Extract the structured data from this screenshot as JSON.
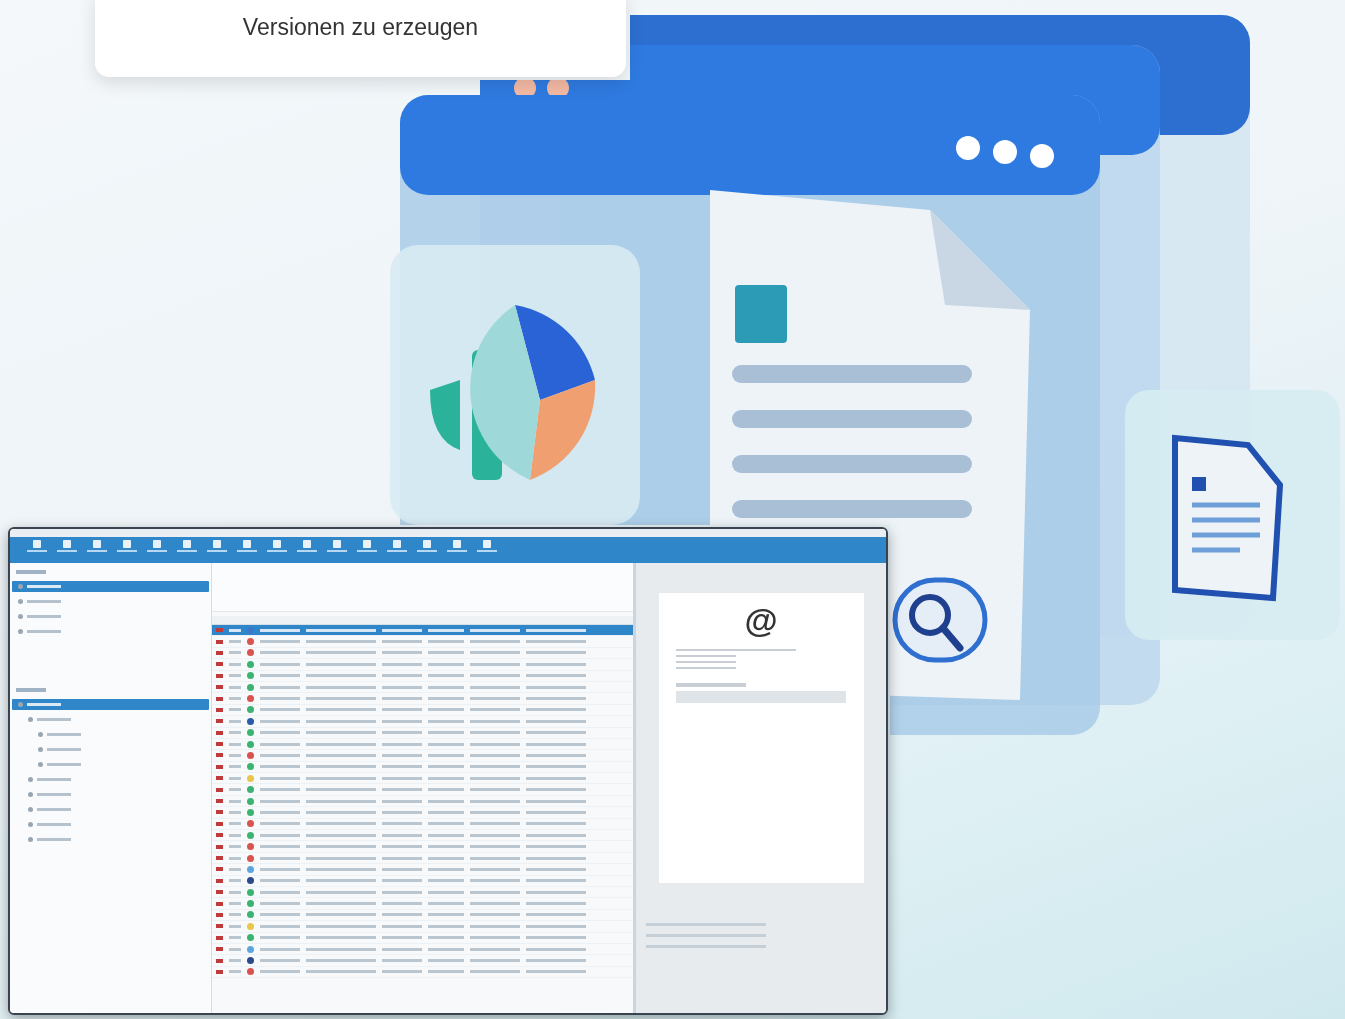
{
  "caption_card": {
    "text": "Versionen zu erzeugen"
  },
  "app_window": {
    "toolbar_buttons": [
      {
        "selected": false
      },
      {
        "selected": false
      },
      {
        "selected": false
      },
      {
        "selected": false
      },
      {
        "selected": false
      },
      {
        "selected": false
      },
      {
        "selected": false
      },
      {
        "selected": false
      },
      {
        "selected": false
      },
      {
        "selected": false
      },
      {
        "selected": false
      },
      {
        "selected": false
      },
      {
        "selected": false
      },
      {
        "selected": false
      },
      {
        "selected": false
      },
      {
        "selected": false
      }
    ],
    "views": [
      {
        "selected": true
      },
      {
        "selected": false
      },
      {
        "selected": false
      },
      {
        "selected": false
      }
    ],
    "folders": [
      {
        "selected": true,
        "children": [
          {
            "selected": false,
            "children": [
              {
                "selected": false
              },
              {
                "selected": false
              },
              {
                "selected": false
              }
            ]
          },
          {
            "selected": false
          },
          {
            "selected": false
          },
          {
            "selected": false
          },
          {
            "selected": false
          },
          {
            "selected": false
          }
        ]
      }
    ],
    "table_rows": [
      {
        "selected": true,
        "color": "#3a78c9"
      },
      {
        "selected": false,
        "color": "#d9534f"
      },
      {
        "selected": false,
        "color": "#d9534f"
      },
      {
        "selected": false,
        "color": "#3cb371"
      },
      {
        "selected": false,
        "color": "#3cb371"
      },
      {
        "selected": false,
        "color": "#3cb371"
      },
      {
        "selected": false,
        "color": "#d9534f"
      },
      {
        "selected": false,
        "color": "#3cb371"
      },
      {
        "selected": false,
        "color": "#2a5caa"
      },
      {
        "selected": false,
        "color": "#3cb371"
      },
      {
        "selected": false,
        "color": "#3cb371"
      },
      {
        "selected": false,
        "color": "#d9534f"
      },
      {
        "selected": false,
        "color": "#3cb371"
      },
      {
        "selected": false,
        "color": "#e8c64a"
      },
      {
        "selected": false,
        "color": "#3cb371"
      },
      {
        "selected": false,
        "color": "#3cb371"
      },
      {
        "selected": false,
        "color": "#3cb371"
      },
      {
        "selected": false,
        "color": "#d9534f"
      },
      {
        "selected": false,
        "color": "#3cb371"
      },
      {
        "selected": false,
        "color": "#d9534f"
      },
      {
        "selected": false,
        "color": "#d9534f"
      },
      {
        "selected": false,
        "color": "#5aa7e0"
      },
      {
        "selected": false,
        "color": "#2a4a8a"
      },
      {
        "selected": false,
        "color": "#3cb371"
      },
      {
        "selected": false,
        "color": "#3cb371"
      },
      {
        "selected": false,
        "color": "#3cb371"
      },
      {
        "selected": false,
        "color": "#e8c64a"
      },
      {
        "selected": false,
        "color": "#3cb371"
      },
      {
        "selected": false,
        "color": "#5aa7e0"
      },
      {
        "selected": false,
        "color": "#2a4a8a"
      },
      {
        "selected": false,
        "color": "#d9534f"
      }
    ],
    "preview": {
      "logo": "@"
    }
  }
}
